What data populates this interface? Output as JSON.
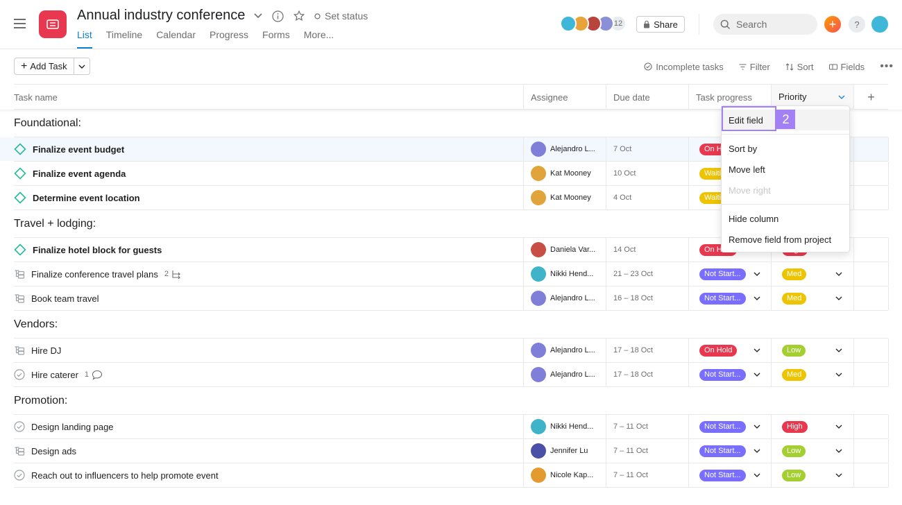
{
  "project": {
    "title": "Annual industry conference",
    "set_status": "Set status",
    "tabs": [
      "List",
      "Timeline",
      "Calendar",
      "Progress",
      "Forms",
      "More..."
    ]
  },
  "header": {
    "member_count": "12",
    "share_label": "Share",
    "search_placeholder": "Search",
    "help_label": "?"
  },
  "toolbar": {
    "add_task": "Add Task",
    "incomplete": "Incomplete tasks",
    "filter": "Filter",
    "sort": "Sort",
    "fields": "Fields"
  },
  "columns": {
    "task_name": "Task name",
    "assignee": "Assignee",
    "due_date": "Due date",
    "task_progress": "Task progress",
    "priority": "Priority",
    "add": "+"
  },
  "sections": [
    {
      "title": "Foundational:",
      "tasks": [
        {
          "name": "Finalize event budget",
          "assignee": "Alejandro L...",
          "due": "7 Oct",
          "progress": "On Hold",
          "priority": ""
        },
        {
          "name": "Finalize event agenda",
          "assignee": "Kat Mooney",
          "due": "10 Oct",
          "progress": "Waiting",
          "priority": ""
        },
        {
          "name": "Determine event location",
          "assignee": "Kat Mooney",
          "due": "4 Oct",
          "progress": "Waiting",
          "priority": ""
        }
      ]
    },
    {
      "title": "Travel + lodging:",
      "tasks": [
        {
          "name": "Finalize hotel block for guests",
          "assignee": "Daniela Var...",
          "due": "14 Oct",
          "progress": "On Hold",
          "priority": "High"
        },
        {
          "name": "Finalize conference travel plans",
          "subcount": "2",
          "assignee": "Nikki Hend...",
          "due": "21 – 23 Oct",
          "progress": "Not Start...",
          "priority": "Med"
        },
        {
          "name": "Book team travel",
          "assignee": "Alejandro L...",
          "due": "16 – 18 Oct",
          "progress": "Not Start...",
          "priority": "Med"
        }
      ]
    },
    {
      "title": "Vendors:",
      "tasks": [
        {
          "name": "Hire DJ",
          "assignee": "Alejandro L...",
          "due": "17 – 18 Oct",
          "progress": "On Hold",
          "priority": "Low"
        },
        {
          "name": "Hire caterer",
          "comments": "1",
          "assignee": "Alejandro L...",
          "due": "17 – 18 Oct",
          "progress": "Not Start...",
          "priority": "Med"
        }
      ]
    },
    {
      "title": "Promotion:",
      "tasks": [
        {
          "name": "Design landing page",
          "assignee": "Nikki Hend...",
          "due": "7 – 11 Oct",
          "progress": "Not Start...",
          "priority": "High"
        },
        {
          "name": "Design ads",
          "assignee": "Jennifer Lu",
          "due": "7 – 11 Oct",
          "progress": "Not Start...",
          "priority": "Low"
        },
        {
          "name": "Reach out to influencers to help promote event",
          "assignee": "Nicole Kap...",
          "due": "7 – 11 Oct",
          "progress": "Not Start...",
          "priority": "Low"
        }
      ]
    }
  ],
  "menu": {
    "edit_field": "Edit field",
    "sort_by": "Sort by",
    "move_left": "Move left",
    "move_right": "Move right",
    "hide_column": "Hide column",
    "remove_field": "Remove field from project",
    "step_badge": "2"
  },
  "colors": {
    "accent": "#0d7fd0",
    "on_hold": "#e8384f",
    "waiting": "#eec300",
    "not_started": "#796eff",
    "high": "#e8384f",
    "med": "#eec300",
    "low": "#a4cf30",
    "highlight": "#a381f5"
  }
}
